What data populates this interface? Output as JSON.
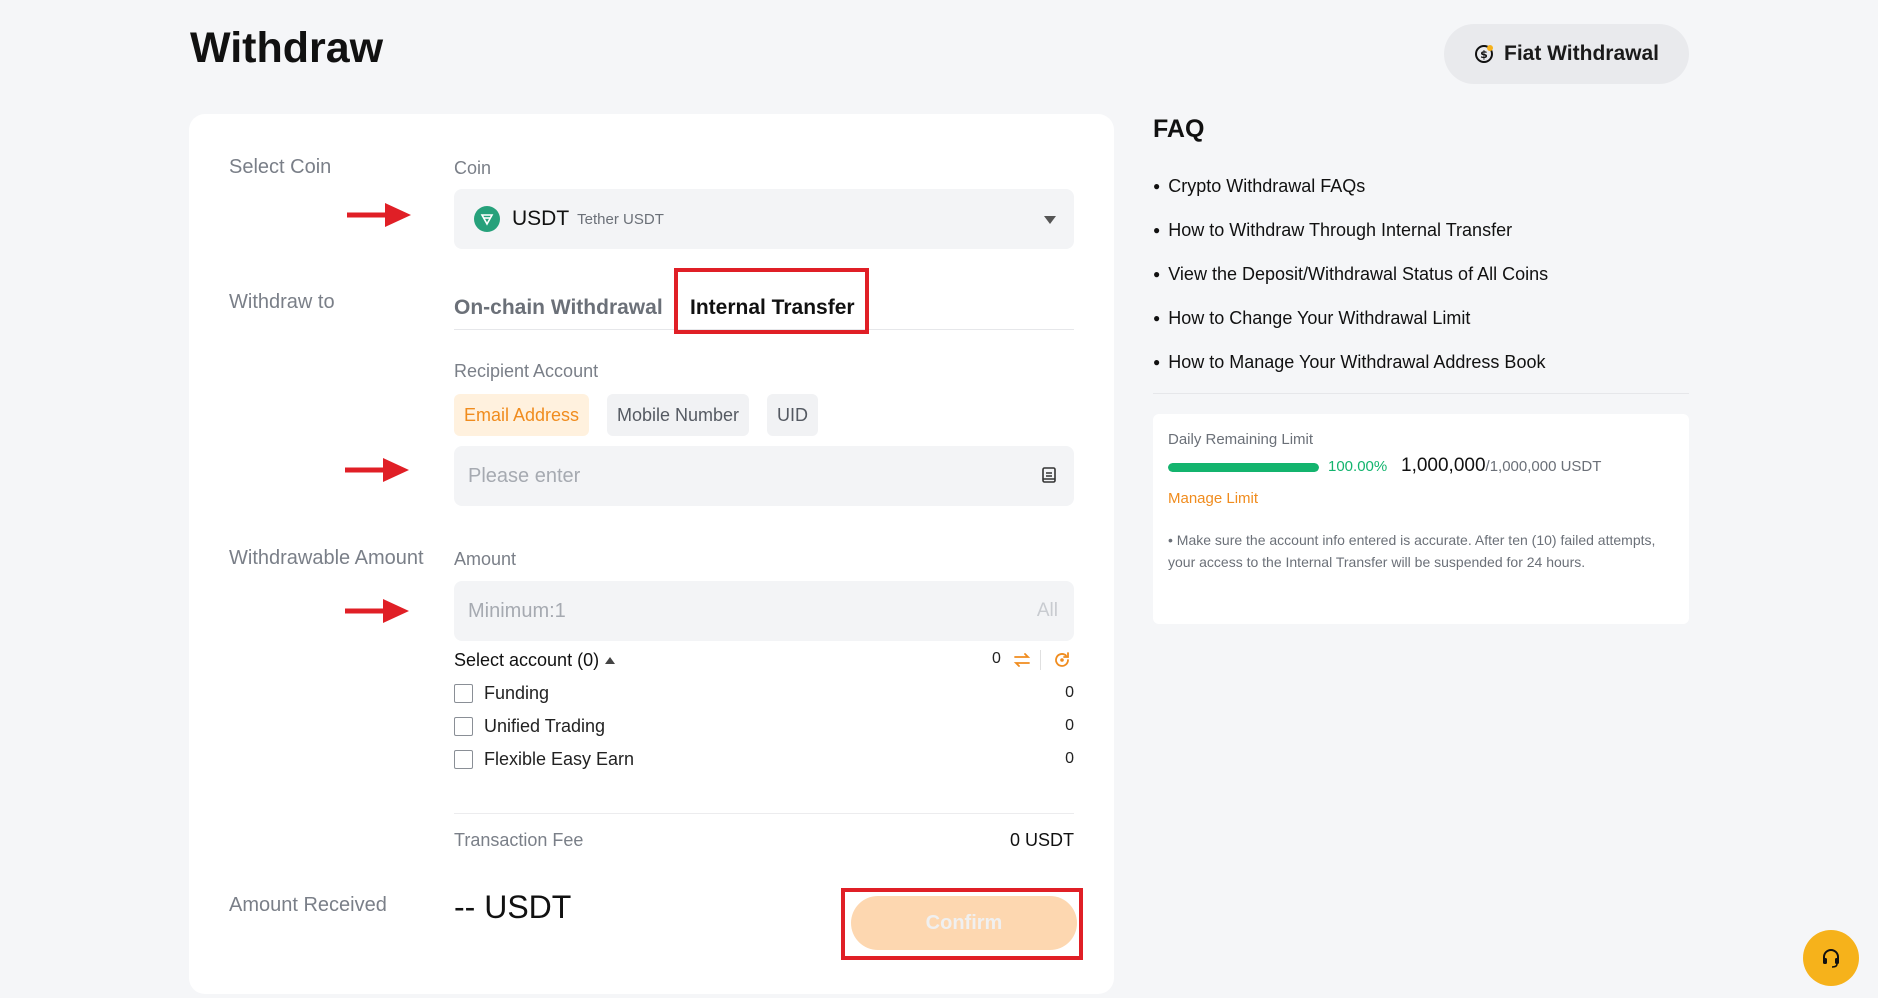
{
  "page": {
    "title": "Withdraw"
  },
  "header": {
    "fiat_label": "Fiat Withdrawal"
  },
  "form": {
    "select_coin_label": "Select Coin",
    "coin_label": "Coin",
    "coin": {
      "symbol": "USDT",
      "name": "Tether USDT"
    },
    "withdraw_to_label": "Withdraw to",
    "tabs": [
      {
        "label": "On-chain Withdrawal",
        "active": false
      },
      {
        "label": "Internal Transfer",
        "active": true
      }
    ],
    "recipient_label": "Recipient Account",
    "recipient_types": [
      {
        "label": "Email Address",
        "active": true
      },
      {
        "label": "Mobile Number",
        "active": false
      },
      {
        "label": "UID",
        "active": false
      }
    ],
    "recipient_placeholder": "Please enter",
    "withdrawable_label": "Withdrawable Amount",
    "amount_label": "Amount",
    "amount_placeholder": "Minimum:1",
    "all_label": "All",
    "select_account_label": "Select account (0)",
    "select_account_total": "0",
    "accounts": [
      {
        "label": "Funding",
        "value": "0"
      },
      {
        "label": "Unified Trading",
        "value": "0"
      },
      {
        "label": "Flexible Easy Earn",
        "value": "0"
      }
    ],
    "fee_label": "Transaction Fee",
    "fee_value": "0 USDT",
    "received_label": "Amount Received",
    "received_value": "-- USDT",
    "confirm_label": "Confirm"
  },
  "faq": {
    "title": "FAQ",
    "items": [
      "Crypto Withdrawal FAQs",
      "How to Withdraw Through Internal Transfer",
      "View the Deposit/Withdrawal Status of All Coins",
      "How to Change Your Withdrawal Limit",
      "How to Manage Your Withdrawal Address Book"
    ]
  },
  "limit": {
    "title": "Daily Remaining Limit",
    "percent": "100.00%",
    "fill_fraction": 1.0,
    "remaining": "1,000,000",
    "total": "/1,000,000 USDT",
    "manage_label": "Manage Limit",
    "note": "• Make sure the account info entered is accurate. After ten (10) failed attempts, your access to the Internal Transfer will be suspended for 24 hours."
  },
  "colors": {
    "accent": "#f08c1e",
    "highlight": "#e01f26",
    "success": "#13b46e",
    "coin": "#26a17b"
  },
  "icons": [
    "fiat-coin-icon",
    "tether-icon",
    "chevron-down-icon",
    "address-book-icon",
    "swap-icon",
    "refresh-icon",
    "arrow-right-icon",
    "headset-icon"
  ]
}
